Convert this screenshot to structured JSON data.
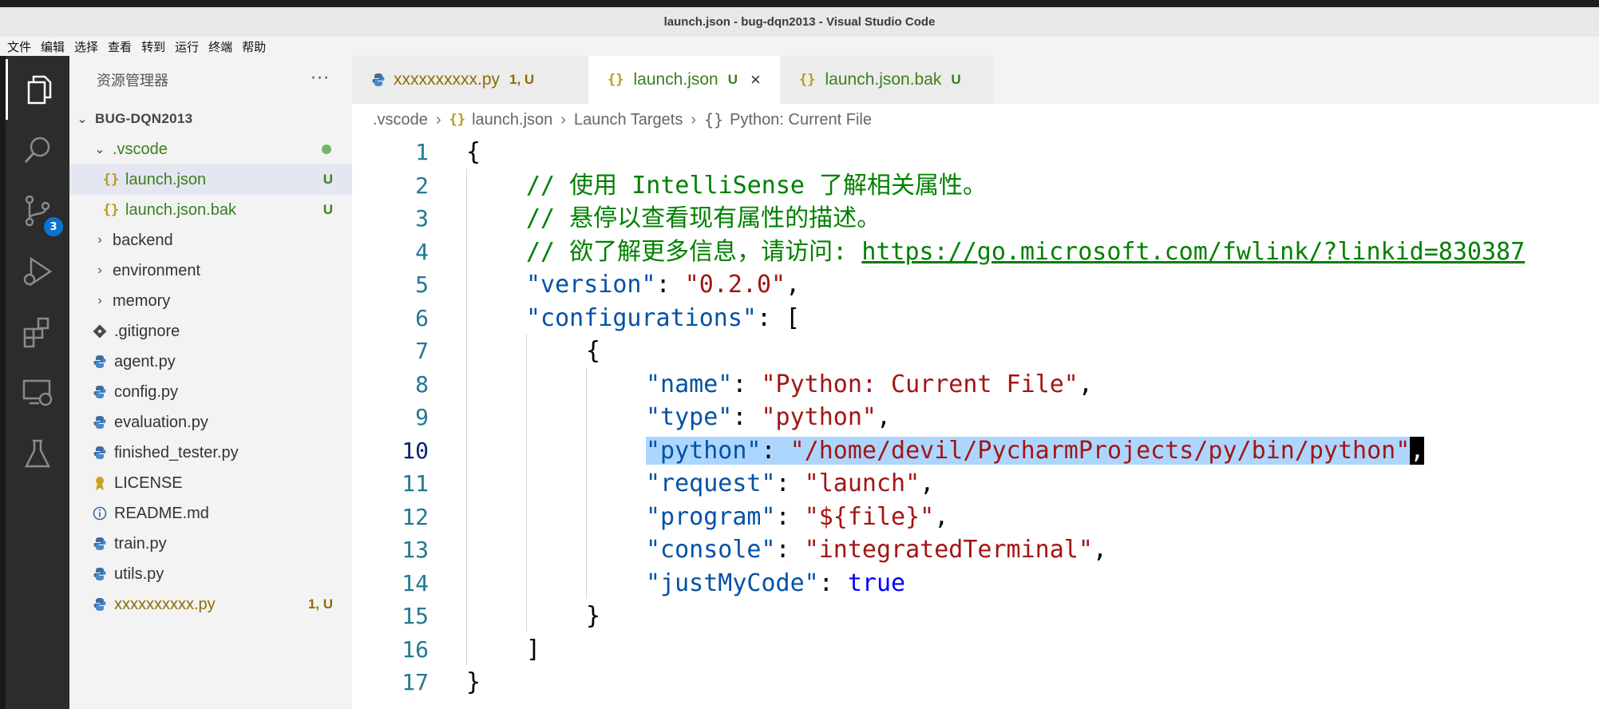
{
  "window": {
    "title": "launch.json - bug-dqn2013 - Visual Studio Code"
  },
  "menu": [
    "文件",
    "编辑",
    "选择",
    "查看",
    "转到",
    "运行",
    "终端",
    "帮助"
  ],
  "activity": {
    "scm_badge": "3"
  },
  "explorer": {
    "title": "资源管理器",
    "more": "···",
    "root": "BUG-DQN2013",
    "items": [
      {
        "label": ".vscode",
        "kind": "folder-open"
      },
      {
        "label": "launch.json",
        "kind": "json",
        "status": "U"
      },
      {
        "label": "launch.json.bak",
        "kind": "json",
        "status": "U"
      },
      {
        "label": "backend",
        "kind": "folder"
      },
      {
        "label": "environment",
        "kind": "folder"
      },
      {
        "label": "memory",
        "kind": "folder"
      },
      {
        "label": ".gitignore",
        "kind": "git"
      },
      {
        "label": "agent.py",
        "kind": "python"
      },
      {
        "label": "config.py",
        "kind": "python"
      },
      {
        "label": "evaluation.py",
        "kind": "python"
      },
      {
        "label": "finished_tester.py",
        "kind": "python"
      },
      {
        "label": "LICENSE",
        "kind": "license"
      },
      {
        "label": "README.md",
        "kind": "info"
      },
      {
        "label": "train.py",
        "kind": "python"
      },
      {
        "label": "utils.py",
        "kind": "python"
      },
      {
        "label": "xxxxxxxxxx.py",
        "kind": "python",
        "status": "1, U"
      }
    ]
  },
  "tabs": [
    {
      "label": "xxxxxxxxxx.py",
      "status": "1, U"
    },
    {
      "label": "launch.json",
      "status": "U",
      "close": "×"
    },
    {
      "label": "launch.json.bak",
      "status": "U"
    }
  ],
  "breadcrumb": [
    ".vscode",
    "launch.json",
    "Launch Targets",
    "Python: Current File"
  ],
  "editor": {
    "line_numbers": [
      "1",
      "2",
      "3",
      "4",
      "5",
      "6",
      "7",
      "8",
      "9",
      "10",
      "11",
      "12",
      "13",
      "14",
      "15",
      "16",
      "17"
    ],
    "current_line": "10",
    "code": {
      "l1": "{",
      "c2": "// 使用 IntelliSense 了解相关属性。",
      "c3": "// 悬停以查看现有属性的描述。",
      "c4": "// 欲了解更多信息，请访问: ",
      "c4_link": "https://go.microsoft.com/fwlink/?linkid=830387",
      "k5": "\"version\"",
      "v5": "\"0.2.0\"",
      "k6": "\"configurations\"",
      "l7": "{",
      "k8": "\"name\"",
      "v8": "\"Python: Current File\"",
      "k9": "\"type\"",
      "v9": "\"python\"",
      "k10": "\"python\"",
      "v10": "\"/home/devil/PycharmProjects/py/bin/python\"",
      "k11": "\"request\"",
      "v11": "\"launch\"",
      "k12": "\"program\"",
      "v12": "\"${file}\"",
      "k13": "\"console\"",
      "v13": "\"integratedTerminal\"",
      "k14": "\"justMyCode\"",
      "v14": "true",
      "l15": "}",
      "l16": "]",
      "l17": "}"
    }
  }
}
